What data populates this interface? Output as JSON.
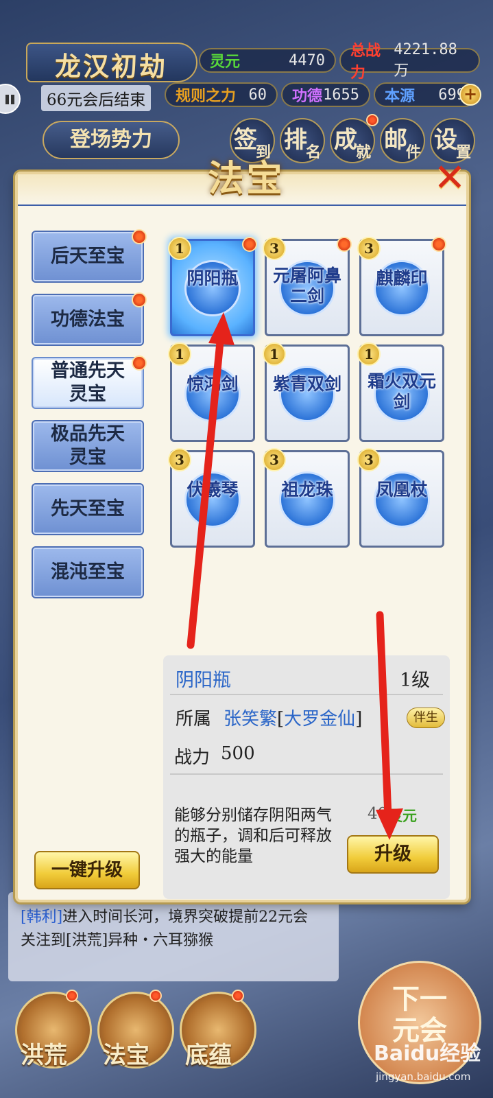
{
  "hud": {
    "title": "龙汉初劫",
    "countdown": "66元会后结束",
    "stats": {
      "lingyuan": {
        "label": "灵元",
        "value": "4470"
      },
      "zhanli": {
        "label": "总战力",
        "value": "4221.88万"
      },
      "guize": {
        "label": "规则之力",
        "value": "60"
      },
      "gongde": {
        "label": "功德",
        "value": "1655"
      },
      "benyuan": {
        "label": "本源",
        "value": "699"
      }
    },
    "faction_button": "登场势力",
    "menu": [
      {
        "big": "签",
        "small": "到"
      },
      {
        "big": "排",
        "small": "名"
      },
      {
        "big": "成",
        "small": "就"
      },
      {
        "big": "邮",
        "small": "件"
      },
      {
        "big": "设",
        "small": "置"
      }
    ]
  },
  "dialog": {
    "title": "法宝",
    "close_glyph": "✕",
    "categories": [
      {
        "label": "后天至宝",
        "badge": true,
        "active": false
      },
      {
        "label": "功德法宝",
        "badge": true,
        "active": false
      },
      {
        "label": "普通先天\n灵宝",
        "badge": true,
        "active": true
      },
      {
        "label": "极品先天\n灵宝",
        "badge": false,
        "active": false
      },
      {
        "label": "先天至宝",
        "badge": false,
        "active": false
      },
      {
        "label": "混沌至宝",
        "badge": false,
        "active": false
      }
    ],
    "upgrade_all_label": "一键升级",
    "treasures": [
      {
        "name": "阴阳瓶",
        "level": "1",
        "badge": true,
        "selected": true
      },
      {
        "name": "元屠阿鼻\n二剑",
        "level": "3",
        "badge": true,
        "selected": false
      },
      {
        "name": "麒麟印",
        "level": "3",
        "badge": true,
        "selected": false
      },
      {
        "name": "惊鸿剑",
        "level": "1",
        "badge": false,
        "selected": false
      },
      {
        "name": "紫青双剑",
        "level": "1",
        "badge": false,
        "selected": false
      },
      {
        "name": "霜火双元\n剑",
        "level": "1",
        "badge": false,
        "selected": false
      },
      {
        "name": "伏羲琴",
        "level": "3",
        "badge": false,
        "selected": false
      },
      {
        "name": "祖龙珠",
        "level": "3",
        "badge": false,
        "selected": false
      },
      {
        "name": "凤凰杖",
        "level": "3",
        "badge": false,
        "selected": false
      }
    ],
    "detail": {
      "name": "阴阳瓶",
      "level": "1级",
      "owner_label": "所属",
      "owner_name": "张笑繁",
      "owner_rank": "大罗金仙",
      "tag": "伴生",
      "power_label": "战力",
      "power_value": "500",
      "description": "能够分别储存阴阳两气的瓶子，调和后可释放强大的能量",
      "cost_value": "40",
      "cost_unit": "灵元",
      "upgrade_label": "升级"
    }
  },
  "log": {
    "line1_name": "[韩利]",
    "line1_text": "进入时间长河，境界突破提前22元会",
    "line2_text": "关注到[洪荒]异种・六耳猕猴"
  },
  "bottom_tabs": [
    "洪荒",
    "法宝",
    "底蕴"
  ],
  "next_turn": "下一\n元会",
  "watermark": {
    "brand": "Baidu经验",
    "url": "jingyan.baidu.com"
  },
  "colors": {
    "accent_blue": "#2b66c8",
    "gold": "#f1cc3a",
    "badge_red": "#c21f0a",
    "annotation_red": "#e5231b"
  }
}
